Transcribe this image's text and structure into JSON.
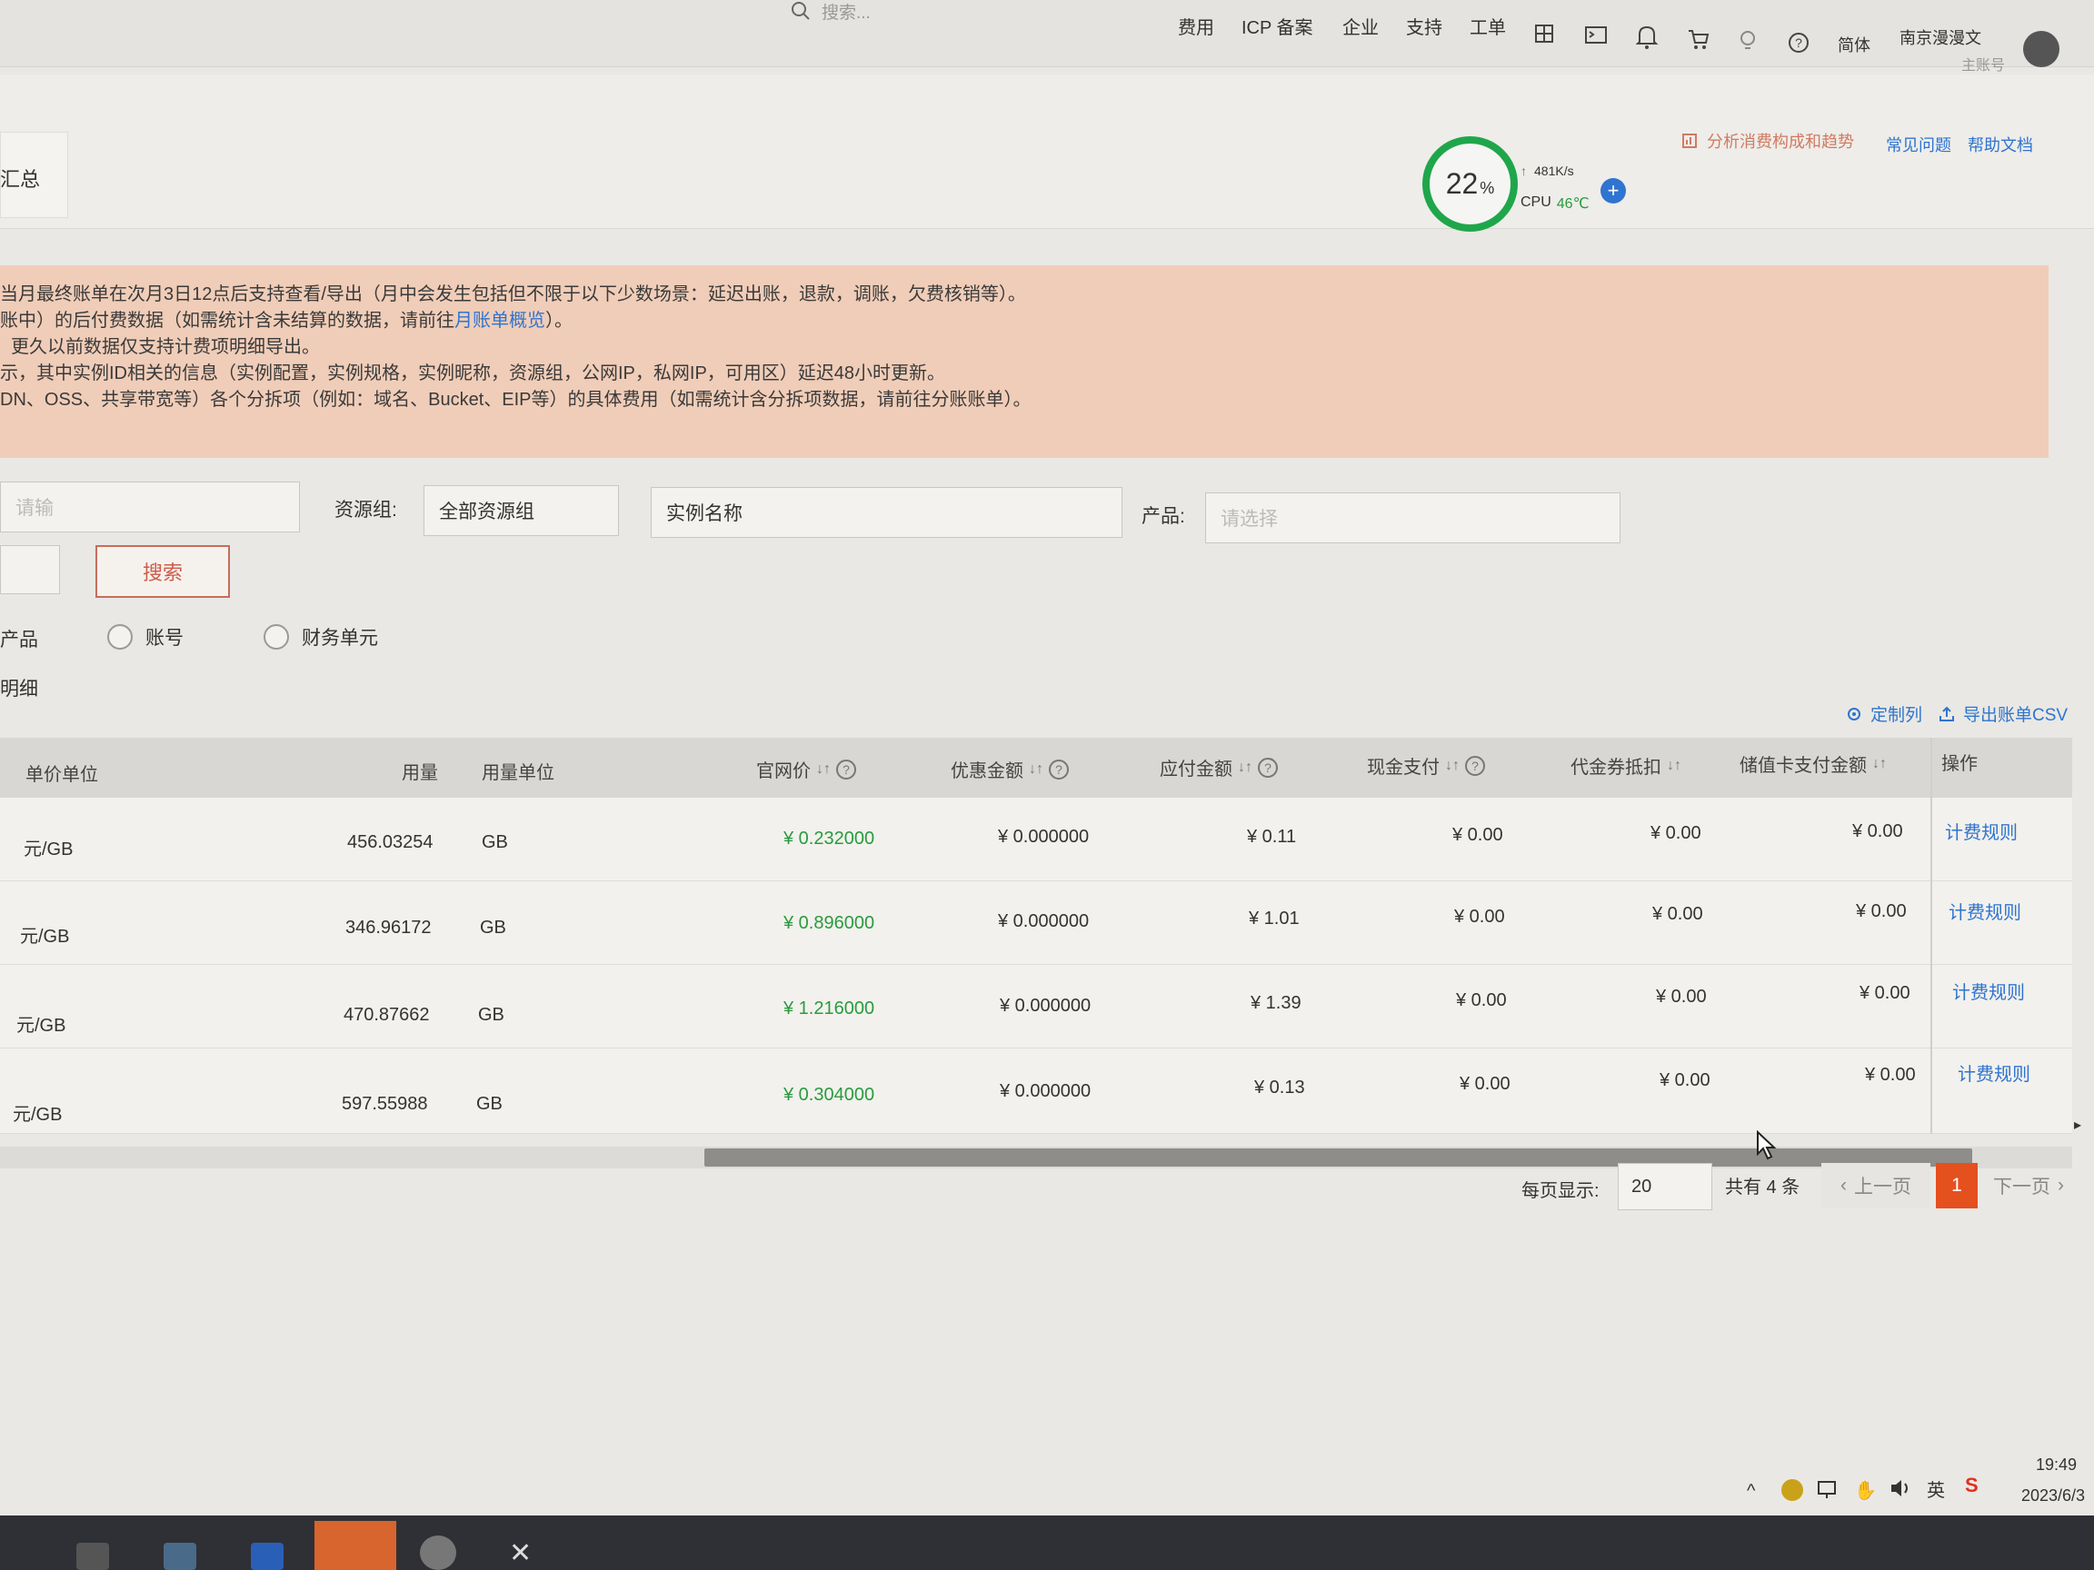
{
  "topnav": {
    "search_placeholder": "搜索...",
    "links": [
      "费用",
      "ICP 备案",
      "企业",
      "支持",
      "工单"
    ],
    "lang": "简体",
    "user_name": "南京漫漫文",
    "user_role": "主账号"
  },
  "header": {
    "tab_label": "汇总",
    "analyze_link": "分析消费构成和趋势",
    "faq_link": "常见问题",
    "help_link": "帮助文档"
  },
  "widget": {
    "percent": "22",
    "percent_unit": "%",
    "speed": "481K/s",
    "cpu_label": "CPU",
    "cpu_temp": "46℃"
  },
  "notice": {
    "lines": [
      "当月最终账单在次月3日12点后支持查看/导出（月中会发生包括但不限于以下少数场景：延迟出账，退款，调账，欠费核销等）。",
      "账中）的后付费数据（如需统计含未结算的数据，请前往",
      "更久以前数据仅支持计费项明细导出。",
      "示，其中实例ID相关的信息（实例配置，实例规格，实例昵称，资源组，公网IP，私网IP，可用区）延迟48小时更新。",
      "DN、OSS、共享带宽等）各个分拆项（例如：域名、Bucket、EIP等）的具体费用（如需统计含分拆项数据，请前往分账账单）。"
    ],
    "link_text": "月账单概览",
    "line2_suffix": "）。"
  },
  "filters": {
    "first_placeholder": "请输",
    "resource_group_label": "资源组:",
    "resource_group_value": "全部资源组",
    "instance_placeholder": "实例名称",
    "product_label": "产品:",
    "product_placeholder": "请选择",
    "search_button": "搜索"
  },
  "grouping": {
    "product_label": "产品",
    "account_label": "账号",
    "finance_label": "财务单元",
    "detail_label": "明细"
  },
  "toolbar": {
    "customize": "定制列",
    "export": "导出账单CSV"
  },
  "table": {
    "headers": [
      "单价单位",
      "用量",
      "用量单位",
      "官网价",
      "优惠金额",
      "应付金额",
      "现金支付",
      "代金券抵扣",
      "储值卡支付金额",
      "操作"
    ],
    "rows": [
      {
        "unit": "元/GB",
        "usage": "456.03254",
        "usage_unit": "GB",
        "list_price": "¥ 0.232000",
        "discount": "¥ 0.000000",
        "payable": "¥ 0.11",
        "cash": "¥ 0.00",
        "voucher": "¥ 0.00",
        "stored": "¥ 0.00",
        "action": "计费规则"
      },
      {
        "unit": "元/GB",
        "usage": "346.96172",
        "usage_unit": "GB",
        "list_price": "¥ 0.896000",
        "discount": "¥ 0.000000",
        "payable": "¥ 1.01",
        "cash": "¥ 0.00",
        "voucher": "¥ 0.00",
        "stored": "¥ 0.00",
        "action": "计费规则"
      },
      {
        "unit": "元/GB",
        "usage": "470.87662",
        "usage_unit": "GB",
        "list_price": "¥ 1.216000",
        "discount": "¥ 0.000000",
        "payable": "¥ 1.39",
        "cash": "¥ 0.00",
        "voucher": "¥ 0.00",
        "stored": "¥ 0.00",
        "action": "计费规则"
      },
      {
        "unit": "元/GB",
        "usage": "597.55988",
        "usage_unit": "GB",
        "list_price": "¥ 0.304000",
        "discount": "¥ 0.000000",
        "payable": "¥ 0.13",
        "cash": "¥ 0.00",
        "voucher": "¥ 0.00",
        "stored": "¥ 0.00",
        "action": "计费规则"
      }
    ]
  },
  "pagination": {
    "per_page_label": "每页显示:",
    "per_page_value": "20",
    "total": "共有 4 条",
    "prev": "上一页",
    "current": "1",
    "next": "下一页"
  },
  "system_tray": {
    "ime": "英",
    "time": "19:49",
    "date": "2023/6/3"
  },
  "colors": {
    "accent": "#2f74d0",
    "notice_bg": "#f0cdb8",
    "price_green": "#2a9a3e",
    "page_active": "#e5501f"
  }
}
